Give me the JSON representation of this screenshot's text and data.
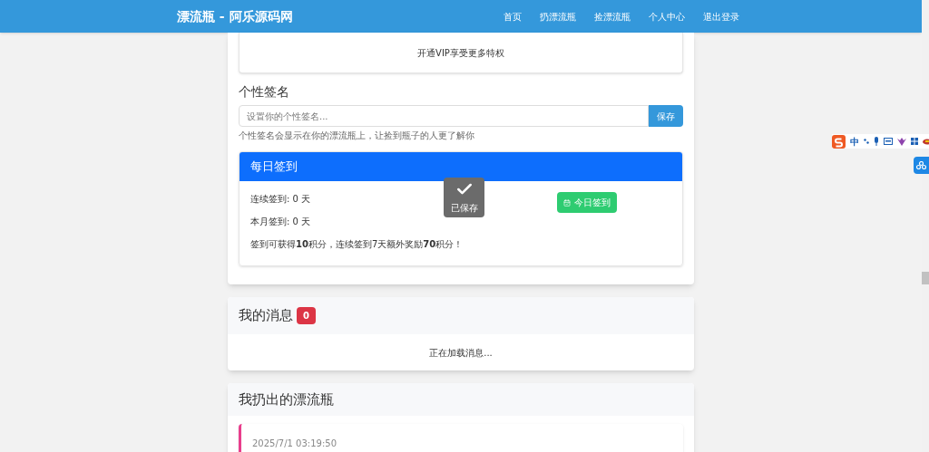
{
  "navbar": {
    "brand": "漂流瓶 - 阿乐源码网",
    "links": [
      {
        "label": "首页"
      },
      {
        "label": "扔漂流瓶"
      },
      {
        "label": "捡漂流瓶"
      },
      {
        "label": "个人中心"
      },
      {
        "label": "退出登录"
      }
    ]
  },
  "vip_card": {
    "text": "开通VIP享受更多特权"
  },
  "signature": {
    "title": "个性签名",
    "placeholder": "设置你的个性签名...",
    "button": "保存",
    "hint": "个性签名会显示在你的漂流瓶上，让捡到瓶子的人更了解你"
  },
  "checkin": {
    "title": "每日签到",
    "lines": [
      "连续签到: 0 天",
      "本月签到: 0 天",
      "签到可获得**10**积分，连续签到7天额外奖励**70**积分！"
    ],
    "button": "今日签到"
  },
  "toast": {
    "text": "已保存"
  },
  "messages": {
    "title": "我的消息",
    "count": "0",
    "status": "正在加载消息..."
  },
  "bottles": {
    "title": "我扔出的漂流瓶",
    "items": [
      {
        "time": "2025/7/1 03:19:50",
        "color": "#e83e8c"
      }
    ]
  },
  "ime_toolbar": {
    "mode": "中"
  }
}
